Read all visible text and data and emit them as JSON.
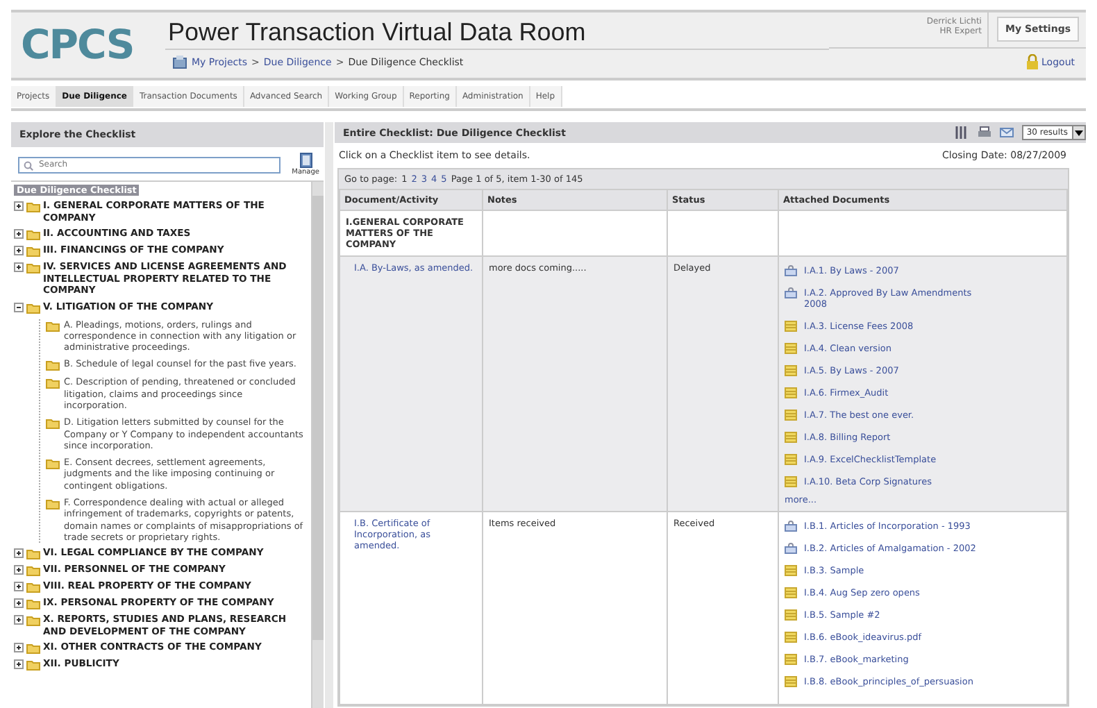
{
  "header": {
    "logo": "CPCS",
    "title": "Power Transaction Virtual Data Room",
    "breadcrumb": [
      "My Projects",
      "Due Diligence",
      "Due Diligence Checklist"
    ],
    "separator": ">",
    "user_name": "Derrick Lichti",
    "user_role": "HR Expert",
    "settings_button": "My Settings",
    "logout": "Logout"
  },
  "tabs": [
    {
      "label": "Projects",
      "selected": false
    },
    {
      "label": "Due Diligence",
      "selected": true
    },
    {
      "label": "Transaction Documents",
      "selected": false
    },
    {
      "label": "Advanced Search",
      "selected": false
    },
    {
      "label": "Working Group",
      "selected": false
    },
    {
      "label": "Reporting",
      "selected": false
    },
    {
      "label": "Administration",
      "selected": false
    },
    {
      "label": "Help",
      "selected": false
    }
  ],
  "sidebar": {
    "title": "Explore the Checklist",
    "search": {
      "placeholder": "Search"
    },
    "manage_label": "Manage",
    "tree": {
      "label": "Due Diligence Checklist",
      "selected": true,
      "children": [
        {
          "label": "I. GENERAL CORPORATE MATTERS OF THE COMPANY",
          "expanded": false
        },
        {
          "label": "II. ACCOUNTING AND TAXES",
          "expanded": false
        },
        {
          "label": "III. FINANCINGS OF THE COMPANY",
          "expanded": false
        },
        {
          "label": "IV. SERVICES AND LICENSE AGREEMENTS AND INTELLECTUAL PROPERTY RELATED TO THE COMPANY",
          "expanded": false
        },
        {
          "label": "V. LITIGATION OF THE COMPANY",
          "expanded": true,
          "children": [
            {
              "label": "A. Pleadings, motions, orders, rulings and correspondence in connection with any litigation or administrative proceedings."
            },
            {
              "label": "B. Schedule of legal counsel for the past five years."
            },
            {
              "label": "C. Description of pending, threatened or concluded litigation, claims and proceedings since incorporation."
            },
            {
              "label": "D. Litigation letters submitted by counsel for the Company or Y Company to independent accountants since incorporation."
            },
            {
              "label": "E. Consent decrees, settlement agreements, judgments and the like imposing continuing or contingent obligations."
            },
            {
              "label": "F. Correspondence dealing with actual or alleged infringement of trademarks, copyrights or patents, domain names or complaints of misappropriations of trade secrets or proprietary rights."
            }
          ]
        },
        {
          "label": "VI. LEGAL COMPLIANCE BY THE COMPANY",
          "expanded": false
        },
        {
          "label": "VII. PERSONNEL OF THE COMPANY",
          "expanded": false
        },
        {
          "label": "VIII. REAL PROPERTY OF THE COMPANY",
          "expanded": false
        },
        {
          "label": "IX. PERSONAL PROPERTY OF THE COMPANY",
          "expanded": false
        },
        {
          "label": "X. REPORTS, STUDIES AND PLANS, RESEARCH AND DEVELOPMENT OF THE COMPANY",
          "expanded": false
        },
        {
          "label": "XI. OTHER CONTRACTS OF THE COMPANY",
          "expanded": false
        },
        {
          "label": "XII. PUBLICITY",
          "expanded": false
        }
      ]
    }
  },
  "main": {
    "title": "Entire Checklist: Due Diligence Checklist",
    "results_select": "30 results",
    "instruction": "Click on a Checklist item to see details.",
    "closing_date": "Closing Date: 08/27/2009",
    "pager": {
      "label": "Go to page:",
      "pages": [
        {
          "label": "1",
          "selected": true
        },
        {
          "label": "2",
          "selected": false
        },
        {
          "label": "3",
          "selected": false
        },
        {
          "label": "4",
          "selected": false
        },
        {
          "label": "5",
          "selected": false
        }
      ],
      "summary": "Page 1 of 5, item 1-30 of 145"
    },
    "table": {
      "columns": [
        "Document/Activity",
        "Notes",
        "Status",
        "Attached Documents"
      ],
      "rows": [
        {
          "kind": "section",
          "activity": "I.GENERAL CORPORATE MATTERS OF THE COMPANY"
        },
        {
          "kind": "item",
          "activity": "I.A. By-Laws, as amended.",
          "notes": "more docs coming.....",
          "status": "Delayed",
          "more": "more...",
          "documents": [
            {
              "kind": "locked",
              "label": "I.A.1. By Laws - 2007"
            },
            {
              "kind": "locked",
              "label": "I.A.2. Approved By Law Amendments 2008"
            },
            {
              "kind": "file",
              "label": "I.A.3. License Fees 2008"
            },
            {
              "kind": "file",
              "label": "I.A.4. Clean version"
            },
            {
              "kind": "file",
              "label": "I.A.5. By Laws - 2007"
            },
            {
              "kind": "file",
              "label": "I.A.6. Firmex_Audit"
            },
            {
              "kind": "file",
              "label": "I.A.7. The best one ever."
            },
            {
              "kind": "file",
              "label": "I.A.8. Billing Report"
            },
            {
              "kind": "file",
              "label": "I.A.9. ExcelChecklistTemplate"
            },
            {
              "kind": "file",
              "label": "I.A.10. Beta Corp Signatures"
            }
          ]
        },
        {
          "kind": "item",
          "activity": "I.B. Certificate of Incorporation, as amended.",
          "notes": "Items received",
          "status": "Received",
          "documents": [
            {
              "kind": "locked",
              "label": "I.B.1. Articles of Incorporation - 1993"
            },
            {
              "kind": "locked",
              "label": "I.B.2. Articles of Amalgamation - 2002"
            },
            {
              "kind": "file",
              "label": "I.B.3. Sample"
            },
            {
              "kind": "file",
              "label": "I.B.4. Aug Sep zero opens"
            },
            {
              "kind": "file",
              "label": "I.B.5. Sample #2"
            },
            {
              "kind": "file",
              "label": "I.B.6. eBook_ideavirus.pdf"
            },
            {
              "kind": "file",
              "label": "I.B.7. eBook_marketing"
            },
            {
              "kind": "file",
              "label": "I.B.8. eBook_principles_of_persuasion"
            }
          ]
        }
      ]
    }
  }
}
